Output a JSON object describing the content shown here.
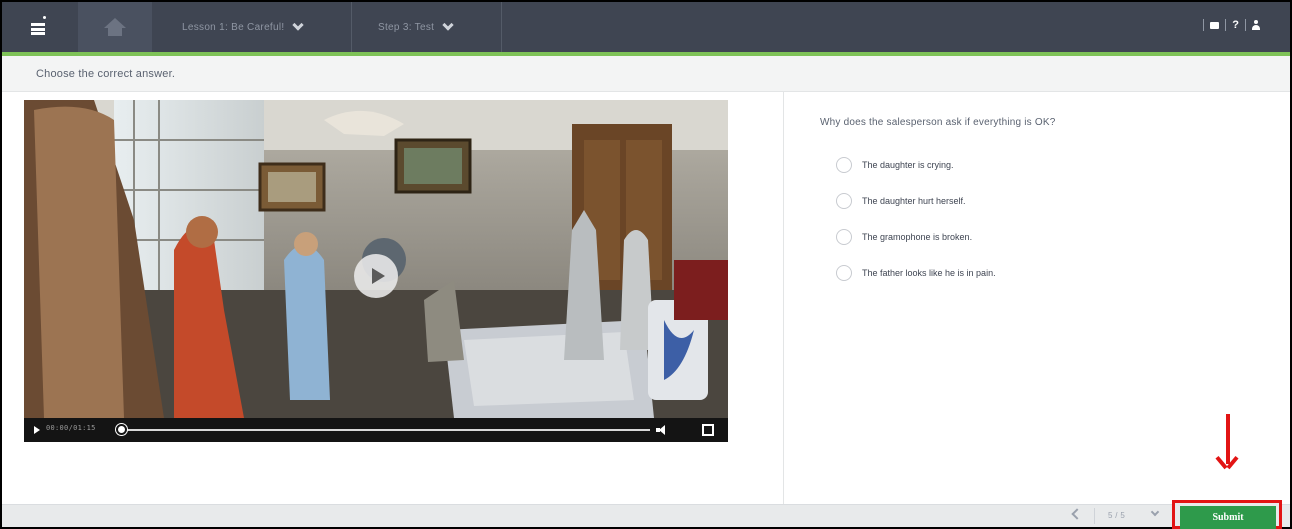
{
  "header": {
    "lesson_label": "Lesson 1: Be Careful!",
    "step_label": "Step 3: Test",
    "help_label": "?"
  },
  "instruction": "Choose the correct answer.",
  "video": {
    "time": "00:00/01:15"
  },
  "question": {
    "text": "Why does the salesperson ask if everything is OK?",
    "options": [
      "The daughter is crying.",
      "The daughter hurt herself.",
      "The gramophone is broken.",
      "The father looks like he is in pain."
    ]
  },
  "footer": {
    "page_indicator": "5 / 5",
    "submit_label": "Submit"
  },
  "colors": {
    "topbar": "#3f4552",
    "accent_green": "#7ec257",
    "submit_green": "#2e9a4b",
    "annotation_red": "#e21414"
  }
}
